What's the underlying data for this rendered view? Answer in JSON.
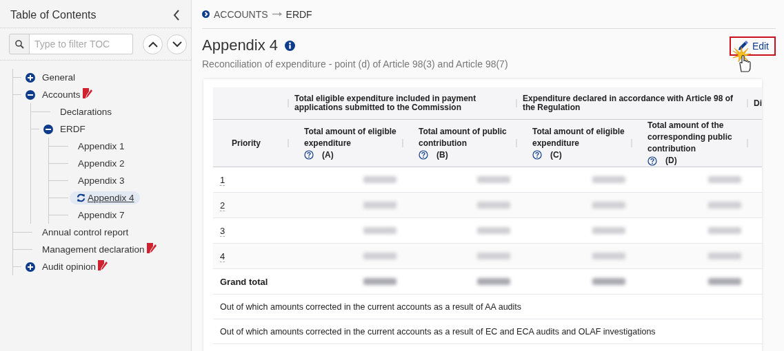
{
  "sidebar": {
    "title": "Table of Contents",
    "filter": {
      "placeholder": "Type to filter TOC"
    },
    "tree": [
      {
        "label": "General",
        "expanded": false,
        "flagged": false,
        "selected": false
      },
      {
        "label": "Accounts",
        "expanded": true,
        "flagged": true,
        "selected": false,
        "children": [
          {
            "label": "Declarations",
            "flagged": false,
            "selected": false
          },
          {
            "label": "ERDF",
            "expanded": true,
            "flagged": false,
            "selected": false,
            "children": [
              {
                "label": "Appendix 1",
                "flagged": false,
                "selected": false
              },
              {
                "label": "Appendix 2",
                "flagged": false,
                "selected": false
              },
              {
                "label": "Appendix 3",
                "flagged": false,
                "selected": false
              },
              {
                "label": "Appendix 4",
                "flagged": false,
                "selected": true
              },
              {
                "label": "Appendix 7",
                "flagged": false,
                "selected": false
              }
            ]
          }
        ]
      },
      {
        "label": "Annual control report",
        "flagged": false,
        "selected": false
      },
      {
        "label": "Management declaration",
        "flagged": true,
        "selected": false
      },
      {
        "label": "Audit opinion",
        "expanded": false,
        "flagged": true,
        "selected": false
      }
    ]
  },
  "breadcrumb": [
    "ACCOUNTS",
    "ERDF"
  ],
  "page": {
    "title": "Appendix 4",
    "subtitle": "Reconciliation of expenditure - point (d) of Article 98(3) and Article 98(7)",
    "edit_button": "Edit"
  },
  "table": {
    "groups": [
      {
        "label": "Total eligible expenditure included in payment applications submitted to the Commission"
      },
      {
        "label": "Expenditure declared in accordance with Article 98 of the Regulation"
      },
      {
        "label": "Di"
      }
    ],
    "columns": [
      {
        "label": "Priority"
      },
      {
        "label": "Total amount of eligible expenditure",
        "help": true,
        "tag": "(A)"
      },
      {
        "label": "Total amount of public contribution",
        "help": true,
        "tag": "(B)"
      },
      {
        "label": "Total amount of eligible expenditure",
        "help": true,
        "tag": "(C)"
      },
      {
        "label": "Total amount of the corresponding public contribution",
        "help": true,
        "tag": "(D)"
      }
    ],
    "rows": [
      {
        "priority": "1",
        "kind": "priority"
      },
      {
        "priority": "2",
        "kind": "priority"
      },
      {
        "priority": "3",
        "kind": "priority"
      },
      {
        "priority": "4",
        "kind": "priority"
      },
      {
        "priority": "Grand total",
        "kind": "total"
      }
    ],
    "notes": [
      "Out of which amounts corrected in the current accounts as a result of AA audits",
      "Out of which amounts corrected in the current accounts as a result of EC and ECA audits and OLAF investigations"
    ]
  }
}
